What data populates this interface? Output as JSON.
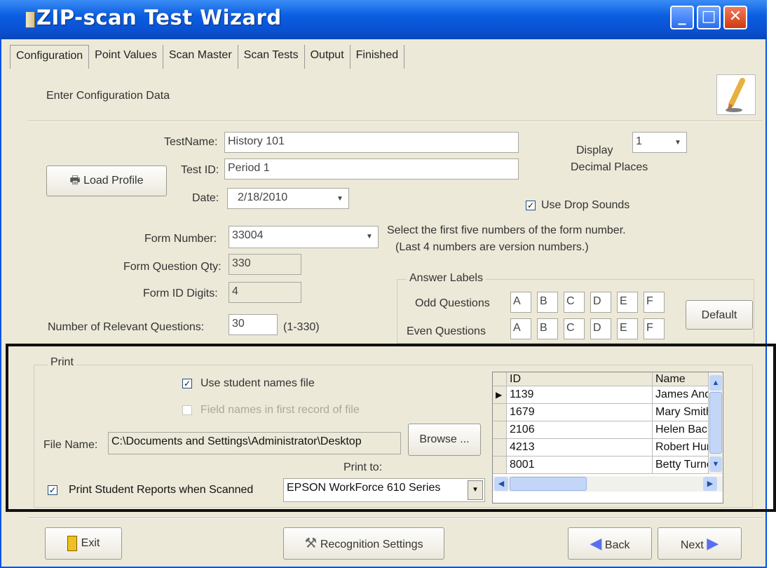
{
  "window": {
    "title": "ZIP-scan Test Wizard",
    "min_glyph": "_",
    "max_glyph": "□",
    "close_glyph": "✕"
  },
  "tabs": [
    {
      "label": "Configuration"
    },
    {
      "label": "Point Values"
    },
    {
      "label": "Scan Master"
    },
    {
      "label": "Scan Tests"
    },
    {
      "label": "Output"
    },
    {
      "label": "Finished"
    }
  ],
  "header": {
    "subtitle": "Enter Configuration Data"
  },
  "config": {
    "load_profile_label": "Load Profile",
    "test_name_label": "TestName:",
    "test_name_value": "History 101",
    "test_id_label": "Test ID:",
    "test_id_value": "Period 1",
    "date_label": "Date:",
    "date_value": "2/18/2010",
    "display_label": "Display",
    "display_value": "1",
    "decimal_places_label": "Decimal Places",
    "use_drop_sounds_label": "Use Drop Sounds",
    "form_number_label": "Form Number:",
    "form_number_value": "33004",
    "form_number_hint1": "Select the first five numbers of the form number.",
    "form_number_hint2": "(Last 4 numbers are version numbers.)",
    "form_question_qty_label": "Form Question Qty:",
    "form_question_qty_value": "330",
    "form_id_digits_label": "Form ID Digits:",
    "form_id_digits_value": "4",
    "relevant_questions_label": "Number of Relevant Questions:",
    "relevant_questions_value": "30",
    "relevant_questions_range": "(1-330)"
  },
  "answer_labels": {
    "group_label": "Answer Labels",
    "odd_label": "Odd Questions",
    "even_label": "Even Questions",
    "odd_values": [
      "A",
      "B",
      "C",
      "D",
      "E",
      "F"
    ],
    "even_values": [
      "A",
      "B",
      "C",
      "D",
      "E",
      "F"
    ],
    "default_button": "Default"
  },
  "print": {
    "group_label": "Print",
    "use_student_names_label": "Use student names file",
    "field_names_label": "Field names in first record of file",
    "file_name_label": "File Name:",
    "file_name_value": "C:\\Documents and Settings\\Administrator\\Desktop",
    "browse_button": "Browse ...",
    "print_to_label": "Print to:",
    "print_reports_label": "Print Student Reports when Scanned",
    "printer_value": "EPSON WorkForce 610 Series"
  },
  "student_grid": {
    "columns": [
      "ID",
      "Name"
    ],
    "rows": [
      [
        "1139",
        "James Anderson"
      ],
      [
        "1679",
        "Mary Smith"
      ],
      [
        "2106",
        "Helen Bachman"
      ],
      [
        "4213",
        "Robert Hurst"
      ],
      [
        "8001",
        "Betty Turner"
      ]
    ]
  },
  "footer": {
    "exit_label": "Exit",
    "recognition_label": "Recognition Settings",
    "back_label": "Back",
    "next_label": "Next"
  },
  "colors": {
    "titlebar": "#0a5ee0",
    "face": "#ece9d8",
    "nav_arrow": "#5a6ff0"
  }
}
